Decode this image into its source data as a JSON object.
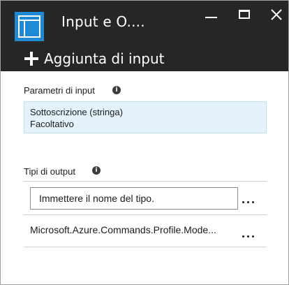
{
  "window": {
    "title": "Input e O....",
    "icon": "blade-layout-icon"
  },
  "toolbar": {
    "add_input_label": "Aggiunta di input",
    "add_icon": "plus-icon"
  },
  "input_params": {
    "label": "Parametri di input",
    "items": [
      {
        "line1": "Sottoscrizione (stringa)",
        "line2": "Facoltativo"
      }
    ]
  },
  "output_types": {
    "label": "Tipi di output",
    "input_placeholder": "Immettere il nome del tipo.",
    "items": [
      {
        "name": "Microsoft.Azure.Commands.Profile.Mode..."
      }
    ]
  },
  "colors": {
    "titlebar": "#262626",
    "accent": "#1e8ad6",
    "selected_bg": "#e4f2fb"
  }
}
